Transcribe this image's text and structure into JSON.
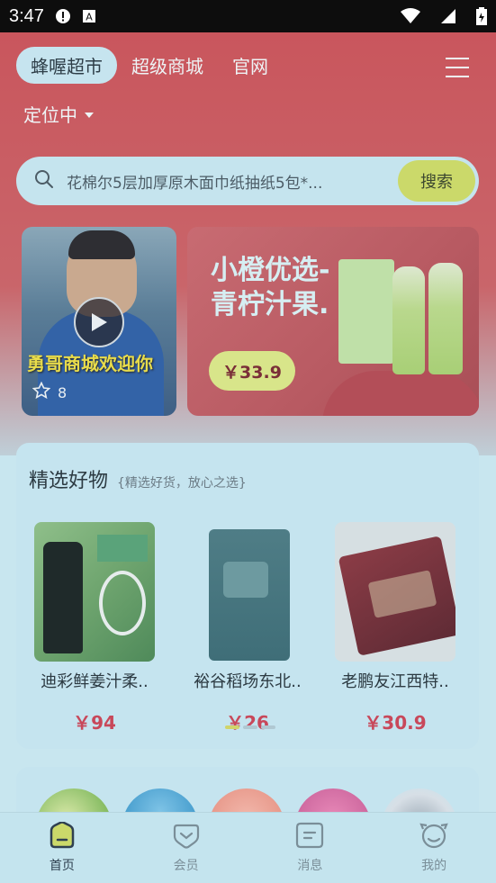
{
  "status_bar": {
    "time": "3:47"
  },
  "header": {
    "tabs": [
      {
        "label": "蜂喔超市",
        "active": true
      },
      {
        "label": "超级商城",
        "active": false
      },
      {
        "label": "官网",
        "active": false
      }
    ],
    "location": "定位中"
  },
  "search": {
    "placeholder": "花棉尔5层加厚原木面巾纸抽纸5包*...",
    "button": "搜索"
  },
  "banner": {
    "video_title": "勇哥商城欢迎你",
    "video_likes": "8",
    "promo_title": "小橙优选-\n青柠汁果.",
    "promo_price": "￥33.9"
  },
  "featured": {
    "title": "精选好物",
    "subtitle": "{精选好货，放心之选}",
    "products": [
      {
        "name": "迪彩鲜姜汁柔..",
        "price": "￥94"
      },
      {
        "name": "裕谷稻场东北..",
        "price": "￥26"
      },
      {
        "name": "老鹏友江西特..",
        "price": "￥30.9"
      }
    ]
  },
  "tab_bar": {
    "items": [
      {
        "label": "首页",
        "icon": "home-icon",
        "active": true
      },
      {
        "label": "会员",
        "icon": "member-icon",
        "active": false
      },
      {
        "label": "消息",
        "icon": "message-icon",
        "active": false
      },
      {
        "label": "我的",
        "icon": "profile-icon",
        "active": false
      }
    ]
  },
  "colors": {
    "hero_red": "#c9565d",
    "accent_yellow": "#cbd96a",
    "price_red": "#c8485a",
    "panel": "#c5e4ef"
  }
}
